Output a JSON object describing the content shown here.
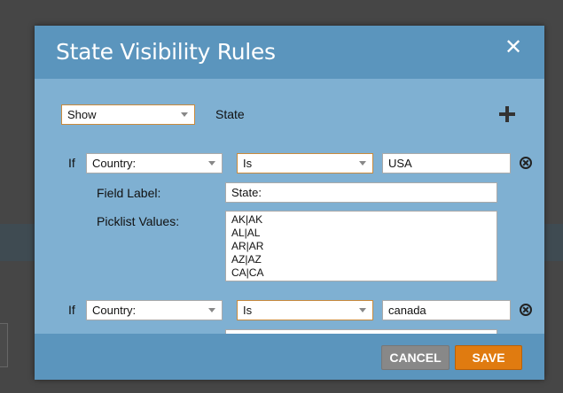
{
  "dialog": {
    "title": "State Visibility Rules"
  },
  "top_row": {
    "visibility_select": "Show",
    "field_label": "State"
  },
  "rules": [
    {
      "if_label": "If",
      "field_select": "Country:",
      "operator_select": "Is",
      "value": "USA",
      "field_label_label": "Field Label:",
      "field_label_value": "State:",
      "picklist_label": "Picklist Values:",
      "picklist_values": [
        "AK|AK",
        "AL|AL",
        "AR|AR",
        "AZ|AZ",
        "CA|CA"
      ]
    },
    {
      "if_label": "If",
      "field_select": "Country:",
      "operator_select": "Is",
      "value": "canada"
    }
  ],
  "footer": {
    "cancel_label": "CANCEL",
    "save_label": "SAVE"
  }
}
